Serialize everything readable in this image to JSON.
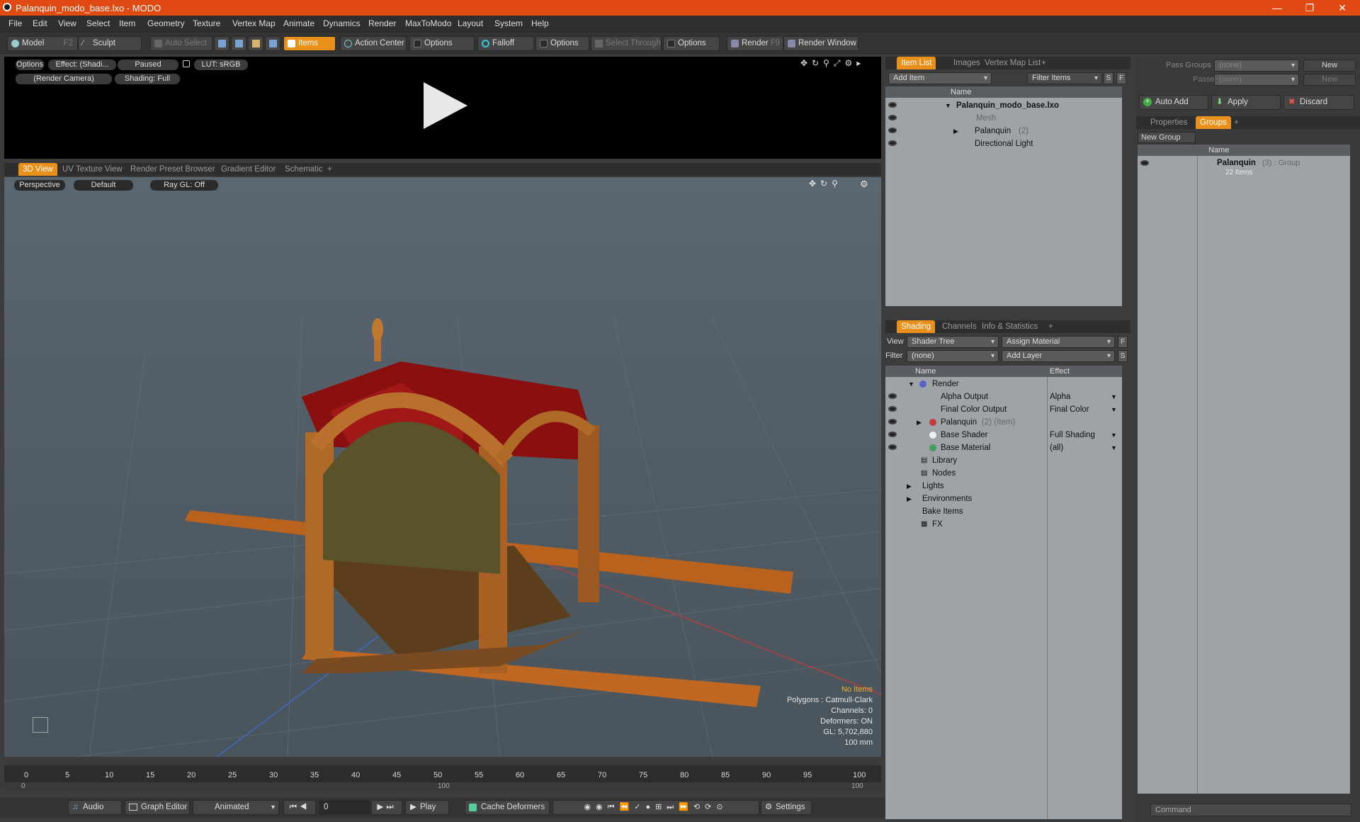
{
  "window": {
    "title": "Palanquin_modo_base.lxo - MODO",
    "minimize": "—",
    "maximize": "❐",
    "close": "✕"
  },
  "menus": [
    "File",
    "Edit",
    "View",
    "Select",
    "Item",
    "Geometry",
    "Texture",
    "Vertex Map",
    "Animate",
    "Dynamics",
    "Render",
    "MaxToModo",
    "Layout",
    "System",
    "Help"
  ],
  "toolbar": {
    "model": "Model",
    "model_key": "F2",
    "sculpt": "Sculpt",
    "auto_select": "Auto Select",
    "items": "Items",
    "action_center": "Action Center",
    "options1": "Options",
    "falloff": "Falloff",
    "options2": "Options",
    "select_through": "Select Through",
    "options3": "Options",
    "render": "Render",
    "render_key": "F9",
    "render_window": "Render Window"
  },
  "render_preview": {
    "options": "Options",
    "effect": "Effect: (Shadi...",
    "paused": "Paused",
    "lut": "LUT: sRGB",
    "camera": "(Render Camera)",
    "shading": "Shading: Full"
  },
  "viewport_tabs": [
    "3D View",
    "UV Texture View",
    "Render Preset Browser",
    "Gradient Editor",
    "Schematic",
    "+"
  ],
  "viewport": {
    "perspective": "Perspective",
    "default": "Default",
    "raygl": "Ray GL: Off",
    "hud": [
      "No Items",
      "Polygons : Catmull-Clark",
      "Channels: 0",
      "Deformers: ON",
      "GL: 5,702,880",
      "100 mm"
    ]
  },
  "timeline": {
    "ticks": [
      "0",
      "5",
      "10",
      "15",
      "20",
      "25",
      "30",
      "35",
      "40",
      "45",
      "50",
      "55",
      "60",
      "65",
      "70",
      "75",
      "80",
      "85",
      "90",
      "95",
      "100"
    ],
    "lower": [
      "0",
      "100",
      "100"
    ]
  },
  "bottombar": {
    "audio": "Audio",
    "graph_editor": "Graph Editor",
    "animated": "Animated",
    "frame": "0",
    "play": "Play",
    "cache": "Cache Deformers",
    "settings": "Settings"
  },
  "item_list": {
    "tabs": [
      "Item List",
      "Images",
      "Vertex Map List",
      "+"
    ],
    "add_item": "Add Item",
    "filter": "Filter Items",
    "s": "S",
    "f": "F",
    "col_name": "Name",
    "rows": [
      {
        "label": "Palanquin_modo_base.lxo",
        "extra": ""
      },
      {
        "label": "Mesh",
        "extra": ""
      },
      {
        "label": "Palanquin",
        "extra": "(2)"
      },
      {
        "label": "Directional Light",
        "extra": ""
      }
    ]
  },
  "shading": {
    "tabs": [
      "Shading",
      "Channels",
      "Info & Statistics",
      "+"
    ],
    "view_label": "View",
    "view_value": "Shader Tree",
    "assign": "Assign Material",
    "f": "F",
    "filter_label": "Filter",
    "filter_value": "(none)",
    "add_layer": "Add Layer",
    "s": "S",
    "col_name": "Name",
    "col_effect": "Effect",
    "rows": [
      {
        "label": "Render",
        "extra": "",
        "effect": ""
      },
      {
        "label": "Alpha Output",
        "extra": "",
        "effect": "Alpha"
      },
      {
        "label": "Final Color Output",
        "extra": "",
        "effect": "Final Color"
      },
      {
        "label": "Palanquin",
        "extra": "(2) (Item)",
        "effect": ""
      },
      {
        "label": "Base Shader",
        "extra": "",
        "effect": "Full Shading"
      },
      {
        "label": "Base Material",
        "extra": "",
        "effect": "(all)"
      },
      {
        "label": "Library",
        "extra": "",
        "effect": ""
      },
      {
        "label": "Nodes",
        "extra": "",
        "effect": ""
      },
      {
        "label": "Lights",
        "extra": "",
        "effect": ""
      },
      {
        "label": "Environments",
        "extra": "",
        "effect": ""
      },
      {
        "label": "Bake Items",
        "extra": "",
        "effect": ""
      },
      {
        "label": "FX",
        "extra": "",
        "effect": ""
      }
    ]
  },
  "groups_panel": {
    "pass_groups": "Pass Groups",
    "passes": "Passes",
    "none": "(none)",
    "new": "New",
    "auto_add": "Auto Add",
    "apply": "Apply",
    "discard": "Discard",
    "tabs": [
      "Properties",
      "Groups",
      "+"
    ],
    "new_group": "New Group",
    "col_name": "Name",
    "group_name": "Palanquin",
    "group_extra": "(3) : Group",
    "group_items": "22 Items"
  },
  "command": {
    "placeholder": "Command"
  }
}
